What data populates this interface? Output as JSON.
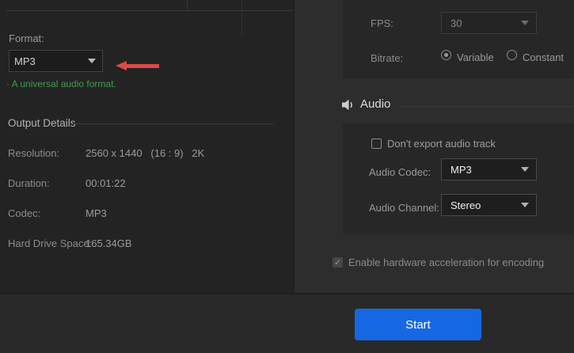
{
  "left_panel": {
    "format_label": "Format:",
    "format_value": "MP3",
    "format_note": "· A universal audio format.",
    "output_details": {
      "title": "Output Details",
      "rows": [
        {
          "label": "Resolution:",
          "value": "2560 x 1440   (16 : 9)   2K"
        },
        {
          "label": "Duration:",
          "value": "00:01:22"
        },
        {
          "label": "Codec:",
          "value": "MP3"
        },
        {
          "label": "Hard Drive Space:",
          "value": "165.34GB"
        }
      ]
    }
  },
  "right_panel": {
    "fps_label": "FPS:",
    "fps_value": "30",
    "bitrate_label": "Bitrate:",
    "bitrate_options": [
      {
        "label": "Variable",
        "selected": true
      },
      {
        "label": "Constant",
        "selected": false
      }
    ],
    "audio_section_title": "Audio",
    "dont_export_checkbox": {
      "label": "Don't export audio track",
      "checked": false
    },
    "audio_codec_label": "Audio Codec:",
    "audio_codec_value": "MP3",
    "audio_channel_label": "Audio Channel:",
    "audio_channel_value": "Stereo",
    "hw_accel_checkbox": {
      "label": "Enable hardware acceleration for encoding",
      "checked": true,
      "checkmark": "✓"
    }
  },
  "footer": {
    "start_label": "Start"
  },
  "colors": {
    "accent_blue": "#1667e4",
    "arrow_red": "#e04848",
    "note_green": "#3f9e4e",
    "panel_dark": "#232323",
    "panel_mid": "#2d2d2d",
    "subpanel": "#272727"
  }
}
